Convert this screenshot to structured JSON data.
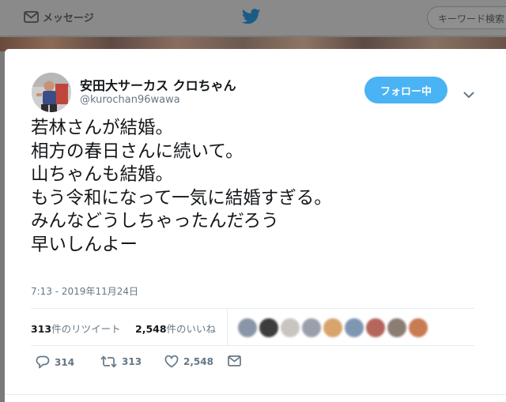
{
  "nav": {
    "messages_label": "メッセージ",
    "search_placeholder": "キーワード検索"
  },
  "tweet": {
    "display_name": "安田大サーカス クロちゃん",
    "handle": "@kurochan96wawa",
    "follow_label": "フォロー中",
    "lines": [
      "若林さんが結婚。",
      "相方の春日さんに続いて。",
      "山ちゃんも結婚。",
      "もう令和になって一気に結婚すぎる。",
      "みんなどうしちゃったんだろう",
      "早いしんよー"
    ],
    "timestamp": "7:13 - 2019年11月24日",
    "stats": {
      "retweets_count": "313",
      "retweets_label": "件のリツイート",
      "likes_count": "2,548",
      "likes_label": "件のいいね"
    },
    "actions": {
      "replies": "314",
      "retweets": "313",
      "likes": "2,548"
    }
  },
  "colors": {
    "accent": "#4ab3f4",
    "secondary_text": "#657786",
    "primary_text": "#14171a"
  },
  "icons": [
    "envelope-icon",
    "twitter-bird-icon",
    "chevron-down-icon",
    "reply-icon",
    "retweet-icon",
    "heart-icon",
    "direct-message-icon"
  ]
}
